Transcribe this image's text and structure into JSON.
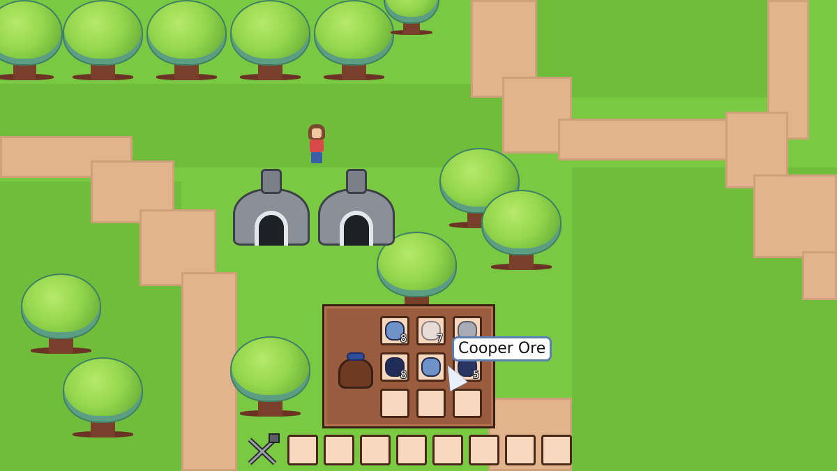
{
  "scene": {
    "grass_color": "#7ac943",
    "path_color": "#e2b48d"
  },
  "tooltip": {
    "text": "Cooper Ore"
  },
  "inventory": {
    "slots": [
      {
        "item": "blue-ore-icon",
        "color": "#6f93c9",
        "qty": "8"
      },
      {
        "item": "silver-ore-icon",
        "color": "#e7ddd6",
        "qty": "7"
      },
      {
        "item": "stone-ore-icon",
        "color": "#a9aab3",
        "qty": ""
      },
      {
        "item": "coal-icon",
        "color": "#1f2c58",
        "qty": "8"
      },
      {
        "item": "copper-ore-icon",
        "color": "#6f93c9",
        "qty": ""
      },
      {
        "item": "dark-ore-icon",
        "color": "#2a3460",
        "qty": "5"
      },
      {
        "item": "",
        "color": "",
        "qty": ""
      },
      {
        "item": "",
        "color": "",
        "qty": ""
      },
      {
        "item": "",
        "color": "",
        "qty": ""
      }
    ]
  },
  "hotbar": {
    "tool_icon": "pickaxe-hammer-icon",
    "slot_count": 8
  }
}
